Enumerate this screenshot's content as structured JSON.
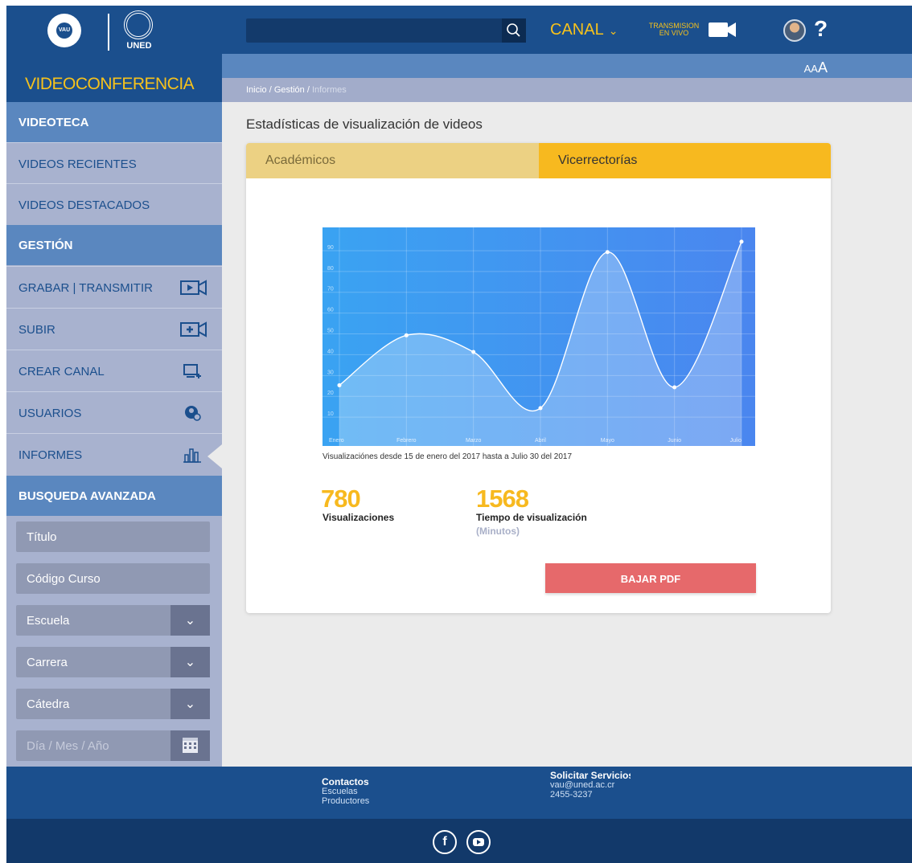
{
  "brand": {
    "vau_label": "VAU",
    "uned_label": "UNED",
    "title": "VIDEOCONFERENCIA"
  },
  "header": {
    "search_placeholder": "",
    "canal_label": "CANAL",
    "live_line1": "TRANSMISION",
    "live_line2": "EN VIVO",
    "help_label": "?",
    "font_size_small": "AA",
    "font_size_big": "A"
  },
  "breadcrumb": {
    "home": "Inicio",
    "sep1": " / ",
    "section": "Gestión",
    "sep2": " / ",
    "current": "Informes"
  },
  "sidebar": {
    "videoteca": "VIDEOTECA",
    "recientes": "VIDEOS RECIENTES",
    "destacados": "VIDEOS DESTACADOS",
    "gestion": "GESTIÓN",
    "grabar": "GRABAR | TRANSMITIR",
    "subir": "SUBIR",
    "crear_canal": "CREAR CANAL",
    "usuarios": "USUARIOS",
    "informes": "INFORMES",
    "busqueda": "BUSQUEDA AVANZADA",
    "titulo": "Título",
    "codigo": "Código Curso",
    "escuela": "Escuela",
    "carrera": "Carrera",
    "catedra": "Cátedra",
    "fecha_placeholder": "Día / Mes / Año"
  },
  "main": {
    "page_title": "Estadísticas de visualización de videos",
    "tab_academicos": "Académicos",
    "tab_vicerrectorias": "Vicerrectorías",
    "caption": "Visualizaciónes desde 15 de enero del 2017 hasta  a Julio 30 del 2017",
    "views_value": "780",
    "views_label": "Visualizaciones",
    "time_value": "1568",
    "time_label": "Tiempo de visualización",
    "time_unit": "(Minutos)",
    "pdf_button": "BAJAR PDF"
  },
  "chart_data": {
    "type": "area",
    "categories": [
      "Enero",
      "Febrero",
      "Marzo",
      "Abril",
      "Mayo",
      "Junio",
      "Julio"
    ],
    "series": [
      {
        "values": [
          23,
          47,
          39,
          12,
          87,
          22,
          92
        ]
      }
    ],
    "ylim": [
      0,
      95
    ],
    "yticks": [
      10,
      20,
      30,
      40,
      50,
      60,
      70,
      80,
      90
    ],
    "grid": true,
    "colors": {
      "bg_top": "#3a9cf0",
      "bg_bottom": "#4a8ef0",
      "line": "#ffffff"
    }
  },
  "footer": {
    "contactos": "Contactos",
    "escuelas": "Escuelas",
    "productores": "Productores",
    "solicitar": "Solicitar Servicios",
    "email": "vau@uned.ac.cr",
    "phone": "2455-3237"
  },
  "colors": {
    "primary": "#1b4f8d",
    "accent": "#f7b91f",
    "danger": "#e6696b"
  }
}
